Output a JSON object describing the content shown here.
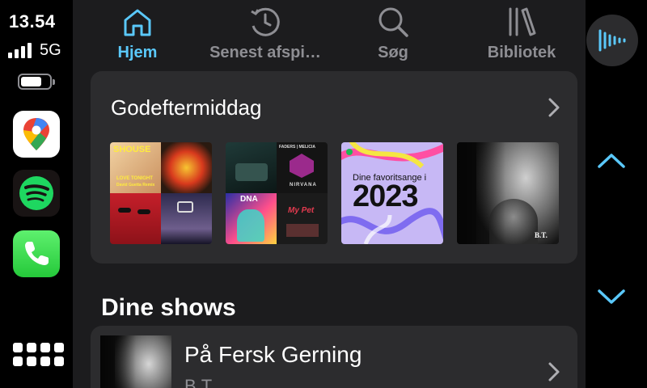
{
  "status": {
    "time": "13.54",
    "network": "5G",
    "battery_level": 0.7
  },
  "dock": {
    "apps": [
      {
        "name": "Maps",
        "icon": "google-maps-icon"
      },
      {
        "name": "Spotify",
        "icon": "spotify-icon"
      },
      {
        "name": "Phone",
        "icon": "phone-icon"
      }
    ]
  },
  "tabs": [
    {
      "label": "Hjem",
      "icon": "home-icon",
      "active": true
    },
    {
      "label": "Senest afspi…",
      "icon": "history-clock-icon",
      "active": false
    },
    {
      "label": "Søg",
      "icon": "search-icon",
      "active": false
    },
    {
      "label": "Bibliotek",
      "icon": "library-icon",
      "active": false
    }
  ],
  "shelf": {
    "title": "Godeftermiddag",
    "items": [
      {
        "type": "mosaic",
        "texts": [
          "SHOUSE",
          "LOVE TONIGHT",
          "David Guetta Remix"
        ]
      },
      {
        "type": "mosaic",
        "texts": [
          "FADERS | MELICIA",
          "NIRVANA",
          "DNA",
          "My Pet"
        ]
      },
      {
        "type": "playlist",
        "texts": [
          "Dine favoritsange i",
          "2023"
        ]
      },
      {
        "type": "podcast",
        "texts": [
          "B.T."
        ]
      }
    ]
  },
  "shows": {
    "title": "Dine shows",
    "items": [
      {
        "title": "På Fersk Gerning",
        "subtitle": "B.T."
      }
    ]
  },
  "colors": {
    "accent": "#5ac8fa",
    "card": "#2c2c2e",
    "background": "#1c1c1e"
  }
}
